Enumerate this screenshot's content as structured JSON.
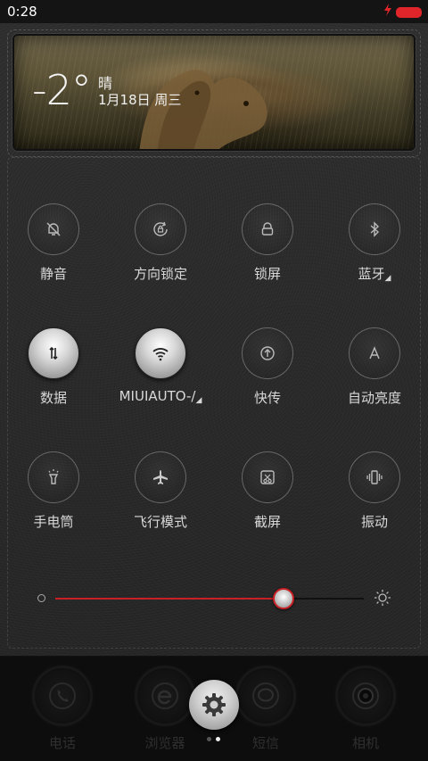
{
  "status_bar": {
    "time": "0:28",
    "charging_icon": "bolt-icon",
    "battery_color": "#e0252a"
  },
  "weather": {
    "temperature": "-2°",
    "condition": "晴",
    "date": "1月18日 周三"
  },
  "toggles": [
    {
      "label": "静音",
      "icon": "bell-off-icon",
      "on": false
    },
    {
      "label": "方向锁定",
      "icon": "rotation-lock-icon",
      "on": false
    },
    {
      "label": "锁屏",
      "icon": "lock-icon",
      "on": false
    },
    {
      "label": "蓝牙",
      "icon": "bluetooth-icon",
      "on": false,
      "has_more": "◢"
    },
    {
      "label": "数据",
      "icon": "data-icon",
      "on": true
    },
    {
      "label": "MIUIAUTO-/",
      "icon": "wifi-icon",
      "on": true,
      "has_more": "◢"
    },
    {
      "label": "快传",
      "icon": "upload-icon",
      "on": false
    },
    {
      "label": "自动亮度",
      "icon": "auto-brightness-icon",
      "on": false
    },
    {
      "label": "手电筒",
      "icon": "flashlight-icon",
      "on": false
    },
    {
      "label": "飞行模式",
      "icon": "airplane-icon",
      "on": false
    },
    {
      "label": "截屏",
      "icon": "screenshot-icon",
      "on": false
    },
    {
      "label": "振动",
      "icon": "vibrate-icon",
      "on": false
    }
  ],
  "brightness": {
    "level_percent": 74,
    "accent": "#c92025"
  },
  "dock": {
    "apps": [
      {
        "label": "电话",
        "icon": "phone-icon"
      },
      {
        "label": "浏览器",
        "icon": "browser-icon"
      },
      {
        "label": "短信",
        "icon": "message-icon"
      },
      {
        "label": "相机",
        "icon": "camera-icon"
      }
    ],
    "settings_icon": "gear-icon",
    "page_count": 2,
    "current_page": 2
  }
}
